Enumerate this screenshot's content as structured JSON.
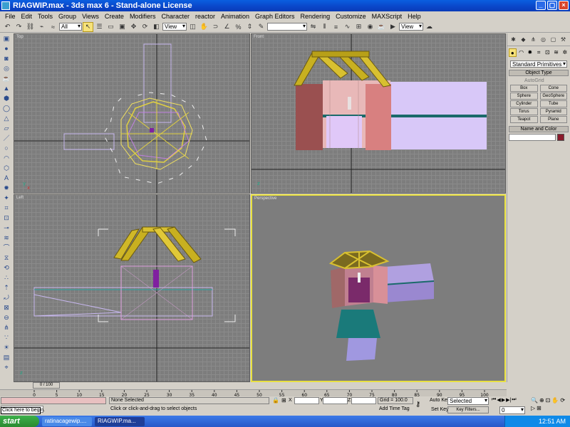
{
  "window": {
    "title": "RIAGWIP.max - 3ds max 6 - Stand-alone License"
  },
  "menu": [
    "File",
    "Edit",
    "Tools",
    "Group",
    "Views",
    "Create",
    "Modifiers",
    "Character",
    "reactor",
    "Animation",
    "Graph Editors",
    "Rendering",
    "Customize",
    "MAXScript",
    "Help"
  ],
  "toolbar": {
    "selection_filter": "All",
    "ref_coord": "View",
    "named_sel": "",
    "render_view": "View"
  },
  "viewports": {
    "top": "Top",
    "front": "Front",
    "left": "Left",
    "perspective": "Perspective"
  },
  "command_panel": {
    "category": "Standard Primitives",
    "object_type_header": "Object Type",
    "autogrid_label": "AutoGrid",
    "primitives": [
      "Box",
      "Cone",
      "Sphere",
      "GeoSphere",
      "Cylinder",
      "Tube",
      "Torus",
      "Pyramid",
      "Teapot",
      "Plane"
    ],
    "name_color_header": "Name and Color",
    "object_color": "#8a1a2a"
  },
  "time": {
    "slider_label": "0 / 100",
    "ticks": [
      "0",
      "5",
      "10",
      "15",
      "20",
      "25",
      "30",
      "35",
      "40",
      "45",
      "50",
      "55",
      "60",
      "65",
      "70",
      "75",
      "80",
      "85",
      "90",
      "95",
      "100"
    ]
  },
  "status": {
    "selection": "None Selected",
    "prompt": "Click or click-and-drag to select objects",
    "x_label": "X",
    "y_label": "Y",
    "z_label": "Z",
    "grid": "Grid = 100.0",
    "add_time_tag": "Add Time Tag",
    "auto_key": "Auto Key",
    "auto_key_mode": "Selected",
    "set_key": "Set Key",
    "key_filters": "Key Filters...",
    "frame": "0",
    "tooltip": "Click here to begin."
  },
  "taskbar": {
    "start": "start",
    "items": [
      "ratinacagewip....",
      "RIAGWIP.ma..."
    ],
    "clock": "12:51 AM"
  }
}
